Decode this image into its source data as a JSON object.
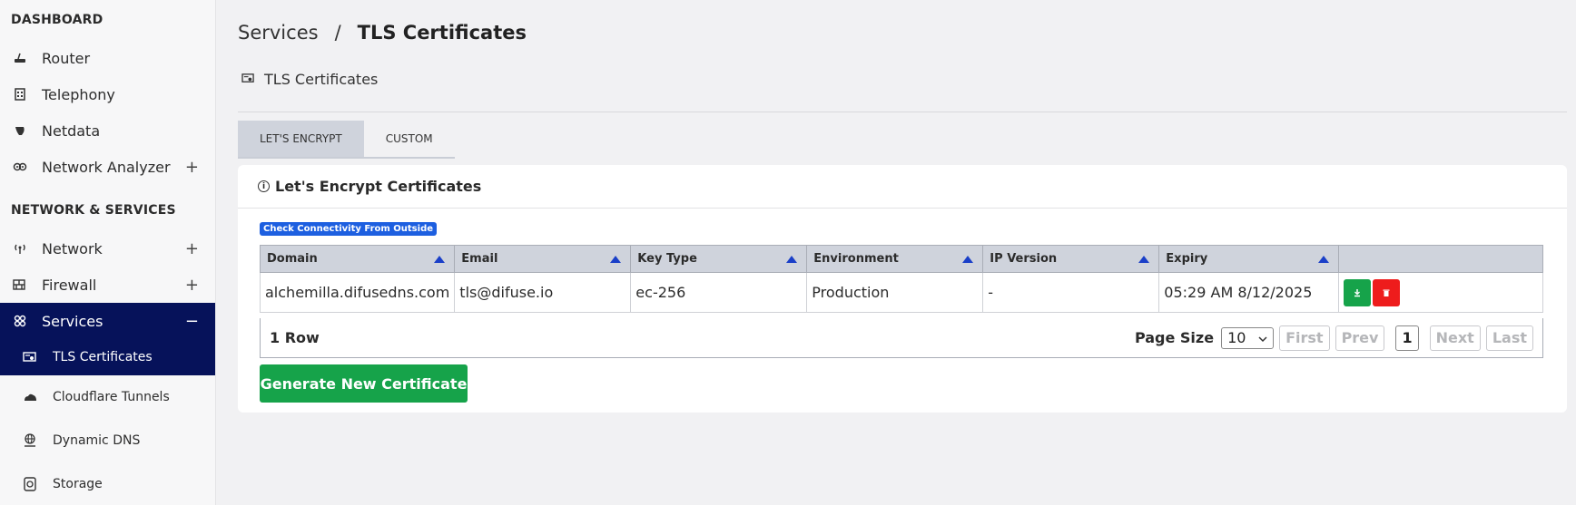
{
  "sidebar": {
    "dashboard_title": "DASHBOARD",
    "dashboard_items": [
      {
        "label": "Router",
        "expandable": false
      },
      {
        "label": "Telephony",
        "expandable": false
      },
      {
        "label": "Netdata",
        "expandable": false
      },
      {
        "label": "Network Analyzer",
        "expandable": true,
        "toggle": "+"
      }
    ],
    "network_title": "NETWORK & SERVICES",
    "network_items": [
      {
        "label": "Network",
        "toggle": "+"
      },
      {
        "label": "Firewall",
        "toggle": "+"
      },
      {
        "label": "Services",
        "toggle": "−"
      }
    ],
    "services_sub": [
      {
        "label": "TLS Certificates"
      },
      {
        "label": "Cloudflare Tunnels"
      },
      {
        "label": "Dynamic DNS"
      },
      {
        "label": "Storage"
      }
    ]
  },
  "header": {
    "breadcrumb_parent": "Services",
    "breadcrumb_sep": "/",
    "breadcrumb_current": "TLS Certificates",
    "subtitle": "TLS Certificates"
  },
  "tabs": [
    "LET'S ENCRYPT",
    "CUSTOM"
  ],
  "card": {
    "title": "Let's Encrypt Certificates",
    "check_button": "Check Connectivity From Outside",
    "columns": [
      "Domain",
      "Email",
      "Key Type",
      "Environment",
      "IP Version",
      "Expiry",
      ""
    ],
    "rows": [
      {
        "domain": "alchemilla.difusedns.com",
        "email": "tls@difuse.io",
        "key_type": "ec-256",
        "environment": "Production",
        "ip_version": "-",
        "expiry": "05:29 AM 8/12/2025"
      }
    ],
    "row_count": "1 Row",
    "page_size_label": "Page Size",
    "page_size": "10",
    "pager": {
      "first": "First",
      "prev": "Prev",
      "current": "1",
      "next": "Next",
      "last": "Last"
    },
    "generate_button": "Generate New Certificate"
  },
  "colors": {
    "sidebar_active": "#06125a",
    "green": "#16a34a",
    "red": "#ee1c1c",
    "badge": "#1d5fe0"
  }
}
